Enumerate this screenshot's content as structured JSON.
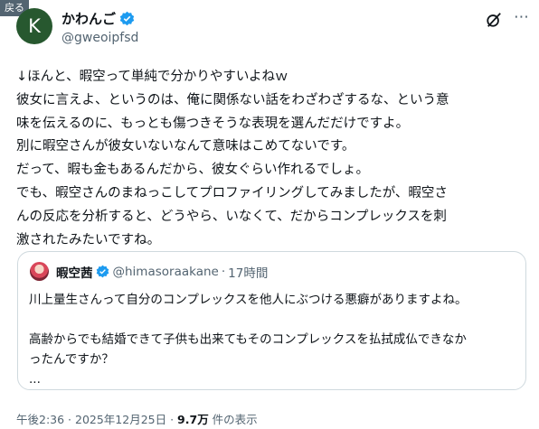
{
  "back_label": "戻る",
  "author": {
    "avatar_letter": "K",
    "avatar_color": "#27582f",
    "display_name": "かわんご",
    "handle": "@gweoipfsd",
    "verified": true
  },
  "header_icons": [
    "grok-icon",
    "more-icon"
  ],
  "more_label": "⋯",
  "tweet_lines": [
    "↓ほんと、暇空って単純で分かりやすいよねｗ",
    "彼女に言えよ、というのは、俺に関係ない話をわざわざするな、という意",
    "味を伝えるのに、もっとも傷つきそうな表現を選んだだけですよ。",
    "別に暇空さんが彼女いないなんて意味はこめてないです。",
    "だって、暇も金もあるんだから、彼女ぐらい作れるでしょ。",
    "でも、暇空さんのまねっこしてプロファイリングしてみましたが、暇空さ",
    "んの反応を分析すると、どうやら、いなくて、だからコンプレックスを刺",
    "激されたみたいですね。"
  ],
  "quote": {
    "display_name": "暇空茜",
    "handle": "@himasoraakane",
    "separator": "·",
    "time": "17時間",
    "verified": true,
    "lines": [
      "川上量生さんって自分のコンプレックスを他人にぶつける悪癖がありますよね。",
      "",
      "高齢からでも結婚できて子供も出来てもそのコンプレックスを払拭成仏できなか",
      "ったんですか？",
      "..."
    ]
  },
  "meta": {
    "timestamp": "午後2:36 · 2025年12月25日 · ",
    "views": "9.7万",
    "views_label": " 件の表示"
  },
  "colors": {
    "accent": "#1d9bf0",
    "text": "#0f1419",
    "secondary": "#536471",
    "border": "#cfd9de"
  }
}
